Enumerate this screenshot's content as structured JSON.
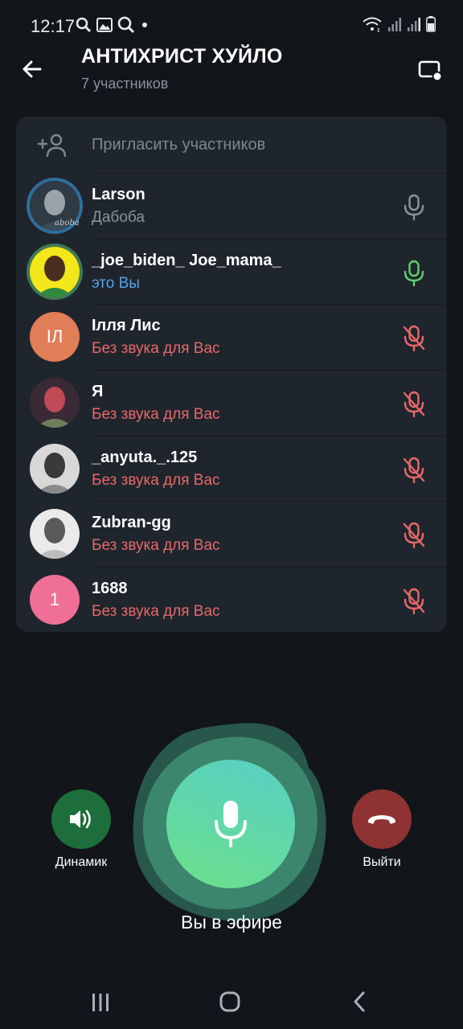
{
  "status_bar": {
    "time": "12:17",
    "left_icons": [
      "search-icon",
      "gallery-icon",
      "chat-search-icon",
      "dot-icon"
    ],
    "right_icons": [
      "wifi-icon",
      "signal-icon",
      "signal-icon-2",
      "battery-icon"
    ]
  },
  "header": {
    "title": "АНТИХРИСТ ХУЙЛО",
    "subtitle": "7 участников"
  },
  "invite": {
    "label": "Пригласить участников",
    "icon": "add-user-icon"
  },
  "participants": [
    {
      "name": "Larson",
      "status": "Дабоба",
      "status_color": "#8a929b",
      "mic": "mic-idle",
      "avatar_type": "photo",
      "avatar_caption": "aboba",
      "mic_color": "#8a929b"
    },
    {
      "name": "_joe_biden_ Joe_mama_",
      "status": "это Вы",
      "status_color": "#4fa3ea",
      "mic": "mic-active",
      "avatar_type": "photo",
      "mic_color": "#5fd16e"
    },
    {
      "name": "Ілля Лис",
      "status": "Без звука для Вас",
      "status_color": "#e8676a",
      "mic": "mic-muted",
      "avatar_type": "initials",
      "initials": "ІЛ",
      "avatar_color": "#e07e57",
      "mic_color": "#e8676a"
    },
    {
      "name": "Я",
      "status": "Без звука для Вас",
      "status_color": "#e8676a",
      "mic": "mic-muted",
      "avatar_type": "photo",
      "mic_color": "#e8676a"
    },
    {
      "name": "_anyuta._.125",
      "status": "Без звука для Вас",
      "status_color": "#e8676a",
      "mic": "mic-muted",
      "avatar_type": "photo",
      "mic_color": "#e8676a"
    },
    {
      "name": "Zubran-gg",
      "status": "Без звука для Вас",
      "status_color": "#e8676a",
      "mic": "mic-muted",
      "avatar_type": "photo",
      "mic_color": "#e8676a"
    },
    {
      "name": "1688",
      "status": "Без звука для Вас",
      "status_color": "#e8676a",
      "mic": "mic-muted",
      "avatar_type": "initials",
      "initials": "1",
      "avatar_color": "#ef6f97",
      "mic_color": "#e8676a"
    }
  ],
  "controls": {
    "speaker_label": "Динамик",
    "leave_label": "Выйти",
    "on_air_label": "Вы в эфире",
    "speaker_color": "#1d6e3a",
    "leave_color": "#8f3233"
  },
  "nav": {
    "icons": [
      "recent-apps-icon",
      "home-icon",
      "back-nav-icon"
    ]
  }
}
